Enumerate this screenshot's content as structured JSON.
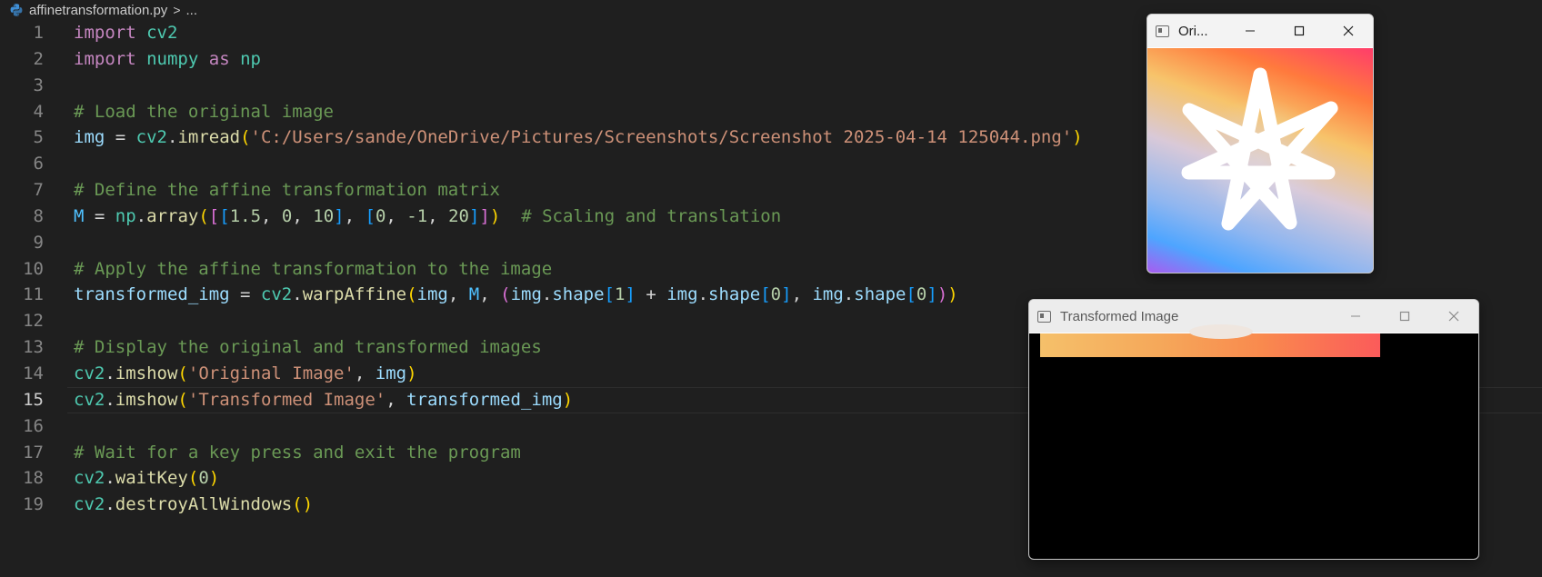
{
  "breadcrumb": {
    "file": "affinetransformation.py",
    "separator": ">",
    "more": "..."
  },
  "editor": {
    "active_line": 15,
    "line_numbers": [
      "1",
      "2",
      "3",
      "4",
      "5",
      "6",
      "7",
      "8",
      "9",
      "10",
      "11",
      "12",
      "13",
      "14",
      "15",
      "16",
      "17",
      "18",
      "19"
    ],
    "lines": [
      [
        [
          "kw",
          "import"
        ],
        [
          "op",
          " "
        ],
        [
          "mod",
          "cv2"
        ]
      ],
      [
        [
          "kw",
          "import"
        ],
        [
          "op",
          " "
        ],
        [
          "mod",
          "numpy"
        ],
        [
          "op",
          " "
        ],
        [
          "kw",
          "as"
        ],
        [
          "op",
          " "
        ],
        [
          "mod",
          "np"
        ]
      ],
      [],
      [
        [
          "cm",
          "# Load the original image"
        ]
      ],
      [
        [
          "var",
          "img"
        ],
        [
          "op",
          " = "
        ],
        [
          "mod",
          "cv2"
        ],
        [
          "op",
          "."
        ],
        [
          "fn",
          "imread"
        ],
        [
          "b1",
          "("
        ],
        [
          "str",
          "'C:/Users/sande/OneDrive/Pictures/Screenshots/Screenshot 2025-04-14 125044.png'"
        ],
        [
          "b1",
          ")"
        ]
      ],
      [],
      [
        [
          "cm",
          "# Define the affine transformation matrix"
        ]
      ],
      [
        [
          "const",
          "M"
        ],
        [
          "op",
          " = "
        ],
        [
          "mod",
          "np"
        ],
        [
          "op",
          "."
        ],
        [
          "fn",
          "array"
        ],
        [
          "b1",
          "("
        ],
        [
          "b2",
          "["
        ],
        [
          "b3",
          "["
        ],
        [
          "num",
          "1.5"
        ],
        [
          "op",
          ", "
        ],
        [
          "num",
          "0"
        ],
        [
          "op",
          ", "
        ],
        [
          "num",
          "10"
        ],
        [
          "b3",
          "]"
        ],
        [
          "op",
          ", "
        ],
        [
          "b3",
          "["
        ],
        [
          "num",
          "0"
        ],
        [
          "op",
          ", "
        ],
        [
          "num",
          "-1"
        ],
        [
          "op",
          ", "
        ],
        [
          "num",
          "20"
        ],
        [
          "b3",
          "]"
        ],
        [
          "b2",
          "]"
        ],
        [
          "b1",
          ")"
        ],
        [
          "op",
          "  "
        ],
        [
          "cm",
          "# Scaling and translation"
        ]
      ],
      [],
      [
        [
          "cm",
          "# Apply the affine transformation to the image"
        ]
      ],
      [
        [
          "var",
          "transformed_img"
        ],
        [
          "op",
          " = "
        ],
        [
          "mod",
          "cv2"
        ],
        [
          "op",
          "."
        ],
        [
          "fn",
          "warpAffine"
        ],
        [
          "b1",
          "("
        ],
        [
          "var",
          "img"
        ],
        [
          "op",
          ", "
        ],
        [
          "const",
          "M"
        ],
        [
          "op",
          ", "
        ],
        [
          "b2",
          "("
        ],
        [
          "var",
          "img"
        ],
        [
          "op",
          "."
        ],
        [
          "var",
          "shape"
        ],
        [
          "b3",
          "["
        ],
        [
          "num",
          "1"
        ],
        [
          "b3",
          "]"
        ],
        [
          "op",
          " + "
        ],
        [
          "var",
          "img"
        ],
        [
          "op",
          "."
        ],
        [
          "var",
          "shape"
        ],
        [
          "b3",
          "["
        ],
        [
          "num",
          "0"
        ],
        [
          "b3",
          "]"
        ],
        [
          "op",
          ", "
        ],
        [
          "var",
          "img"
        ],
        [
          "op",
          "."
        ],
        [
          "var",
          "shape"
        ],
        [
          "b3",
          "["
        ],
        [
          "num",
          "0"
        ],
        [
          "b3",
          "]"
        ],
        [
          "b2",
          ")"
        ],
        [
          "b1",
          ")"
        ]
      ],
      [],
      [
        [
          "cm",
          "# Display the original and transformed images"
        ]
      ],
      [
        [
          "mod",
          "cv2"
        ],
        [
          "op",
          "."
        ],
        [
          "fn",
          "imshow"
        ],
        [
          "b1",
          "("
        ],
        [
          "str",
          "'Original Image'"
        ],
        [
          "op",
          ", "
        ],
        [
          "var",
          "img"
        ],
        [
          "b1",
          ")"
        ]
      ],
      [
        [
          "mod",
          "cv2"
        ],
        [
          "op",
          "."
        ],
        [
          "fn",
          "imshow"
        ],
        [
          "b1",
          "("
        ],
        [
          "str",
          "'Transformed Image'"
        ],
        [
          "op",
          ", "
        ],
        [
          "var",
          "transformed_img"
        ],
        [
          "b1",
          ")"
        ]
      ],
      [],
      [
        [
          "cm",
          "# Wait for a key press and exit the program"
        ]
      ],
      [
        [
          "mod",
          "cv2"
        ],
        [
          "op",
          "."
        ],
        [
          "fn",
          "waitKey"
        ],
        [
          "b1",
          "("
        ],
        [
          "num",
          "0"
        ],
        [
          "b1",
          ")"
        ]
      ],
      [
        [
          "mod",
          "cv2"
        ],
        [
          "op",
          "."
        ],
        [
          "fn",
          "destroyAllWindows"
        ],
        [
          "b1",
          "()"
        ]
      ]
    ]
  },
  "windows": {
    "original": {
      "title": "Ori...",
      "icon": "app-window-icon"
    },
    "transformed": {
      "title": "Transformed Image",
      "icon": "app-window-icon"
    }
  },
  "colors": {
    "editor_bg": "#1f1f1f",
    "keyword": "#c586c0",
    "module": "#4ec9b0",
    "comment": "#6a9955",
    "string": "#ce9178",
    "number": "#b5cea8",
    "function": "#dcdcaa",
    "variable": "#9cdcfe"
  }
}
